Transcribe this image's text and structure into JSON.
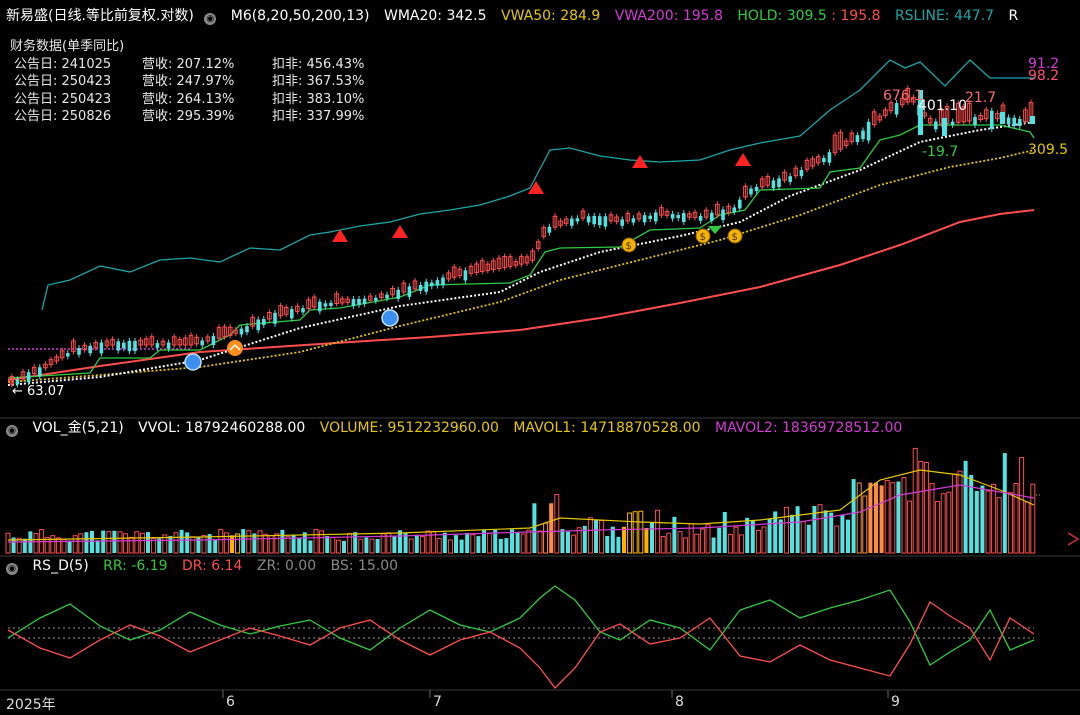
{
  "header": {
    "title": "新易盛(日线.等比前复权.对数)",
    "m6": "M6(8,20,50,200,13)",
    "wma20": "WMA20: 342.5",
    "vwa50": "VWA50: 284.9",
    "vwa200": "VWA200: 195.8",
    "hold": "HOLD: 309.5",
    "hold2": ": 195.8",
    "rsline": "RSLINE: 447.7",
    "r": "R"
  },
  "financial": {
    "title": "财务数据(单季同比)",
    "rows": [
      {
        "date": "公告日: 241025",
        "rev": "营收: 207.12%",
        "np": "扣非: 456.43%"
      },
      {
        "date": "公告日: 250423",
        "rev": "营收: 247.97%",
        "np": "扣非: 367.53%"
      },
      {
        "date": "公告日: 250423",
        "rev": "营收: 264.13%",
        "np": "扣非: 383.10%"
      },
      {
        "date": "公告日: 250826",
        "rev": "营收: 295.39%",
        "np": "扣非: 337.99%"
      }
    ]
  },
  "price_labels": {
    "low": "← 63.07",
    "p676": "676.1",
    "p401": "401.10",
    "p217": "21.7",
    "m197": "-19.7",
    "r912": "91.2",
    "r982": "98.2",
    "r3095": "309.5"
  },
  "vol": {
    "title": "VOL_金(5,21)",
    "vvol": "VVOL: 18792460288.00",
    "volume": "VOLUME: 9512232960.00",
    "mavol1": "MAVOL1: 14718870528.00",
    "mavol2": "MAVOL2: 18369728512.00"
  },
  "rsd": {
    "title": "RS_D(5)",
    "rr": "RR: -6.19",
    "dr": "DR: 6.14",
    "zr": "ZR: 0.00",
    "bs": "BS: 15.00"
  },
  "xaxis": {
    "y2025": "2025年",
    "m6": "6",
    "m7": "7",
    "m8": "8",
    "m9": "9"
  },
  "colors": {
    "up": "#ff4d4d",
    "down": "#4fe3e3",
    "yellow": "#e6c800",
    "green": "#2ecc40",
    "magenta": "#d53ad5",
    "teal": "#1aa6a6",
    "orange": "#ff8c42",
    "gold": "#ffb300"
  },
  "icons": [
    "eye-toggle-icon",
    "red-triangle-marker",
    "blue-sphere-marker",
    "money-bag-marker",
    "orange-chevron-marker"
  ]
}
